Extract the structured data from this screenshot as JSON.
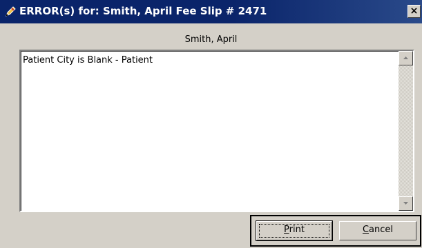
{
  "window": {
    "title": "ERROR(s) for: Smith, April  Fee Slip # 2471",
    "close_symbol": "×",
    "icon": "pencil-error-icon"
  },
  "patient_name": "Smith, April",
  "messages": {
    "text": "Patient City is Blank - Patient"
  },
  "buttons": {
    "print": {
      "first": "P",
      "rest": "rint"
    },
    "cancel": {
      "first": "C",
      "rest": "ancel"
    }
  }
}
